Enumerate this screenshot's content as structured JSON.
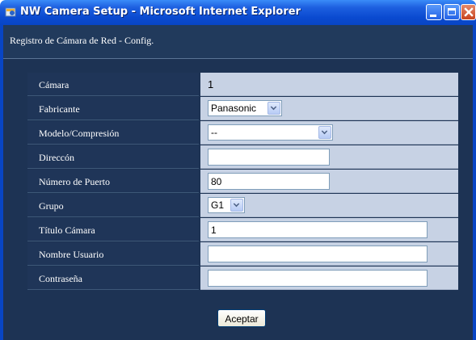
{
  "window": {
    "title": "NW Camera Setup - Microsoft Internet Explorer",
    "icons": [
      "ie-app-icon",
      "minimize-icon",
      "maximize-icon",
      "close-icon"
    ],
    "colors": {
      "titlebar": "#0a4ad0",
      "header_bg": "#213a5c",
      "label_bg": "#1f3558",
      "value_bg": "#c7d2e4",
      "close_btn": "#c8431e"
    }
  },
  "page": {
    "heading": "Registro de Cámara de Red - Config."
  },
  "form": {
    "camera": {
      "label": "Cámara",
      "value": "1"
    },
    "manufacturer": {
      "label": "Fabricante",
      "value": "Panasonic"
    },
    "model": {
      "label": "Modelo/Compresión",
      "value": "--"
    },
    "address": {
      "label": "Direccón",
      "value": ""
    },
    "port": {
      "label": "Número de Puerto",
      "value": "80"
    },
    "group": {
      "label": "Grupo",
      "value": "G1"
    },
    "camera_title": {
      "label": "Título Cámara",
      "value": "1"
    },
    "username": {
      "label": "Nombre Usuario",
      "value": ""
    },
    "password": {
      "label": "Contraseña",
      "value": ""
    }
  },
  "actions": {
    "accept_label": "Aceptar"
  }
}
